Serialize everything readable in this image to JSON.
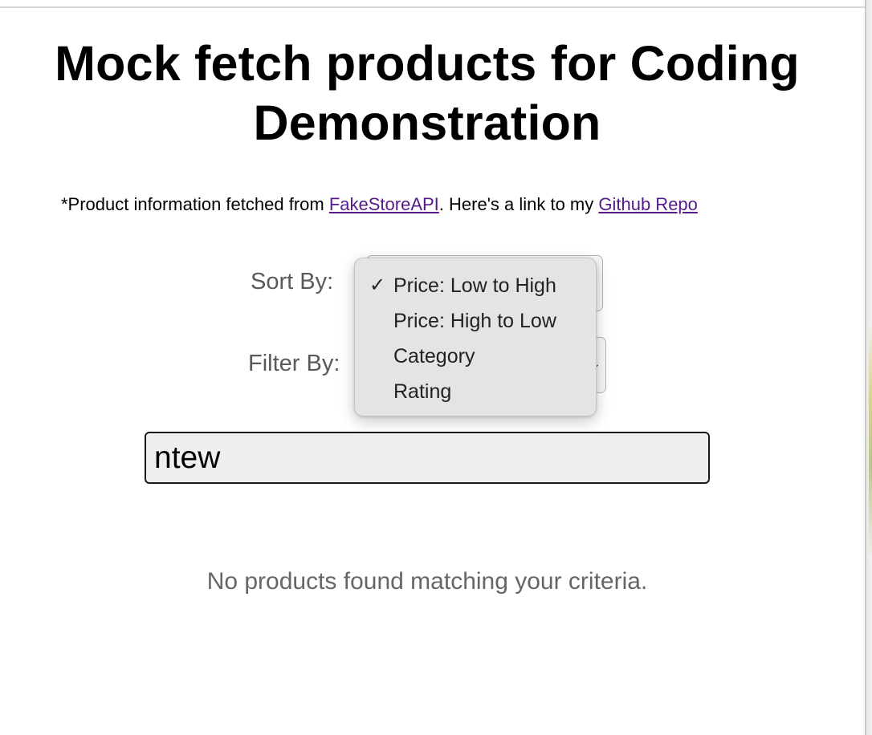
{
  "page": {
    "title": "Mock fetch products for Coding Demonstration",
    "credit": {
      "prefix": "*Product information fetched from ",
      "api_link": "FakeStoreAPI",
      "middle": ". Here's a link to my ",
      "repo_link": "Github Repo"
    }
  },
  "controls": {
    "sort_label": "Sort By:",
    "filter_label": "Filter By:",
    "sort_options": [
      {
        "label": "Price: Low to High",
        "selected": true
      },
      {
        "label": "Price: High to Low",
        "selected": false
      },
      {
        "label": "Category",
        "selected": false
      },
      {
        "label": "Rating",
        "selected": false
      }
    ],
    "check_glyph": "✓",
    "search_value": "ntew"
  },
  "results": {
    "empty_message": "No products found matching your criteria."
  },
  "colors": {
    "link": "#551a8b",
    "label_text": "#5a5a5a",
    "dropdown_bg": "#e4e4e4"
  }
}
